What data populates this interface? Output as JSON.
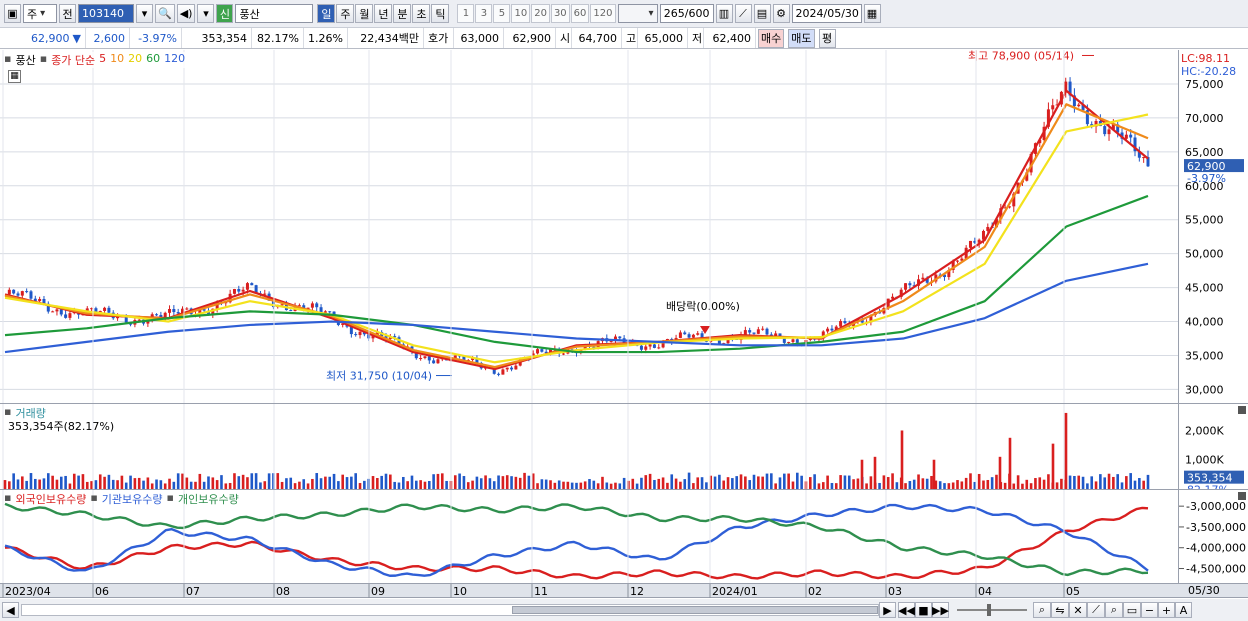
{
  "toolbar": {
    "market": "주",
    "prev_label": "전",
    "code": "103140",
    "market_badge": "신",
    "name": "풍산",
    "periods": [
      "일",
      "주",
      "월",
      "년",
      "분",
      "초",
      "틱"
    ],
    "intervals": [
      "1",
      "3",
      "5",
      "10",
      "20",
      "30",
      "60",
      "120"
    ],
    "count": "265",
    "count_max": "/600",
    "date": "2024/05/30"
  },
  "quote": {
    "price": "62,900",
    "change": "2,600",
    "change_pct": "-3.97%",
    "volume": "353,354",
    "vol_ratio": "82.17%",
    "turnover": "1.26%",
    "amount": "22,434백만",
    "ask_label": "호가",
    "ask1": "63,000",
    "ask2": "62,900",
    "open_label": "시",
    "open": "64,700",
    "high_label": "고",
    "high": "65,000",
    "low_label": "저",
    "low": "62,400",
    "buy_label": "매수",
    "sell_label": "매도",
    "eval_label": "평"
  },
  "price_pane": {
    "tab": "풍산",
    "legend_prefix": "종가 단순",
    "ma_labels": [
      "5",
      "10",
      "20",
      "60",
      "120"
    ],
    "lc": "LC:98.11",
    "hc": "HC:-20.28",
    "current_price": "62,900",
    "current_pct": "-3.97%",
    "high_annotation": "최고 78,900 (05/14)",
    "low_annotation": "최저 31,750 (10/04)",
    "dividend_annotation": "배당락(0.00%)"
  },
  "volume_pane": {
    "title": "거래량",
    "sub": "353,354주(82.17%)",
    "current": "353,354",
    "current_pct": "82.17%"
  },
  "holder_pane": {
    "labels": [
      "외국인보유수량",
      "기관보유수량",
      "개인보유수량"
    ]
  },
  "x_axis": {
    "labels": [
      "2023/04",
      "06",
      "07",
      "08",
      "09",
      "10",
      "11",
      "12",
      "2024/01",
      "02",
      "03",
      "04",
      "05"
    ],
    "right_label": "05/30"
  },
  "colors": {
    "up": "#d91f1f",
    "down": "#1f58c8",
    "ma5": "#d91f1f",
    "ma10": "#ef8a1a",
    "ma20": "#f3e21d",
    "ma60": "#1e9a3a",
    "ma120": "#2f5fd6",
    "foreign": "#d91f1f",
    "institution": "#2f5fd6",
    "individual": "#2f8f4e"
  },
  "chart_data": [
    {
      "type": "candlestick",
      "x": [
        "2023/04",
        "05",
        "06",
        "07",
        "08",
        "09",
        "10",
        "11",
        "12",
        "2024/01",
        "02",
        "03",
        "04",
        "05/14",
        "05/30"
      ],
      "close": [
        44000,
        41000,
        40500,
        44500,
        40500,
        35500,
        33000,
        36500,
        37000,
        38000,
        37500,
        44000,
        52000,
        74000,
        62900
      ],
      "ylim": [
        28000,
        80000
      ],
      "yticks": [
        30000,
        35000,
        40000,
        45000,
        50000,
        55000,
        60000,
        65000,
        70000,
        75000
      ],
      "ytick_labels": [
        "30,000",
        "35,000",
        "40,000",
        "45,000",
        "50,000",
        "55,000",
        "60,000",
        "65,000",
        "70,000",
        "75,000"
      ],
      "series": [
        {
          "name": "5",
          "values": [
            44000,
            41000,
            40500,
            44500,
            40500,
            35500,
            33000,
            36500,
            37000,
            38000,
            37500,
            44000,
            52000,
            74000,
            64000
          ]
        },
        {
          "name": "10",
          "values": [
            43800,
            41200,
            40400,
            44000,
            40800,
            35800,
            33300,
            36300,
            37000,
            37800,
            37600,
            43000,
            51000,
            72000,
            67000
          ]
        },
        {
          "name": "20",
          "values": [
            43500,
            41500,
            40000,
            43000,
            41000,
            36500,
            34000,
            35800,
            36900,
            37500,
            37700,
            41500,
            48500,
            68000,
            70500
          ]
        },
        {
          "name": "60",
          "values": [
            38000,
            39000,
            40500,
            41500,
            41000,
            39500,
            37000,
            35500,
            35500,
            36000,
            37000,
            38500,
            43000,
            54000,
            58500
          ]
        },
        {
          "name": "120",
          "values": [
            35500,
            37000,
            38500,
            39500,
            40000,
            39500,
            38500,
            37500,
            37000,
            36500,
            36500,
            37500,
            40500,
            46000,
            48500
          ]
        }
      ],
      "annotations": {
        "high": 78900,
        "low": 31750
      }
    },
    {
      "type": "bar",
      "title": "거래량",
      "yticks": [
        1000000,
        2000000
      ],
      "ytick_labels": [
        "1,000K",
        "2,000K"
      ],
      "spikes": [
        {
          "x": "2024/03",
          "values": [
            1000000,
            1100000,
            2000000,
            1000000
          ]
        },
        {
          "x": "2024/04",
          "values": [
            1100000,
            1750000
          ]
        },
        {
          "x": "2024/05",
          "values": [
            1550000,
            2600000
          ]
        }
      ],
      "last": 353354
    },
    {
      "type": "line",
      "yticks": [
        -3000000,
        -3500000,
        -4000000,
        -4500000
      ],
      "ytick_labels": [
        "-3,000,000",
        "-3,500,000",
        "-4,000,000",
        "-4,500,000"
      ],
      "series": [
        {
          "name": "외국인보유수량",
          "values": [
            -4000000,
            -4500000,
            -4000000,
            -3900000,
            -4300000,
            -4500000,
            -4500000,
            -4700000,
            -4600000,
            -4700000,
            -4600000,
            -4700000,
            -4500000,
            -3600000,
            -3050000
          ]
        },
        {
          "name": "기관보유수량",
          "values": [
            -4000000,
            -4600000,
            -3600000,
            -3800000,
            -4400000,
            -4700000,
            -4200000,
            -3900000,
            -4300000,
            -3500000,
            -3200000,
            -3000000,
            -3100000,
            -3600000,
            -4500000
          ]
        },
        {
          "name": "개인보유수량",
          "values": [
            -3000000,
            -3200000,
            -3500000,
            -3300000,
            -3200000,
            -3000000,
            -3100000,
            -3000000,
            -3300000,
            -3300000,
            -3500000,
            -4000000,
            -4200000,
            -4600000,
            -4550000
          ]
        }
      ]
    }
  ]
}
